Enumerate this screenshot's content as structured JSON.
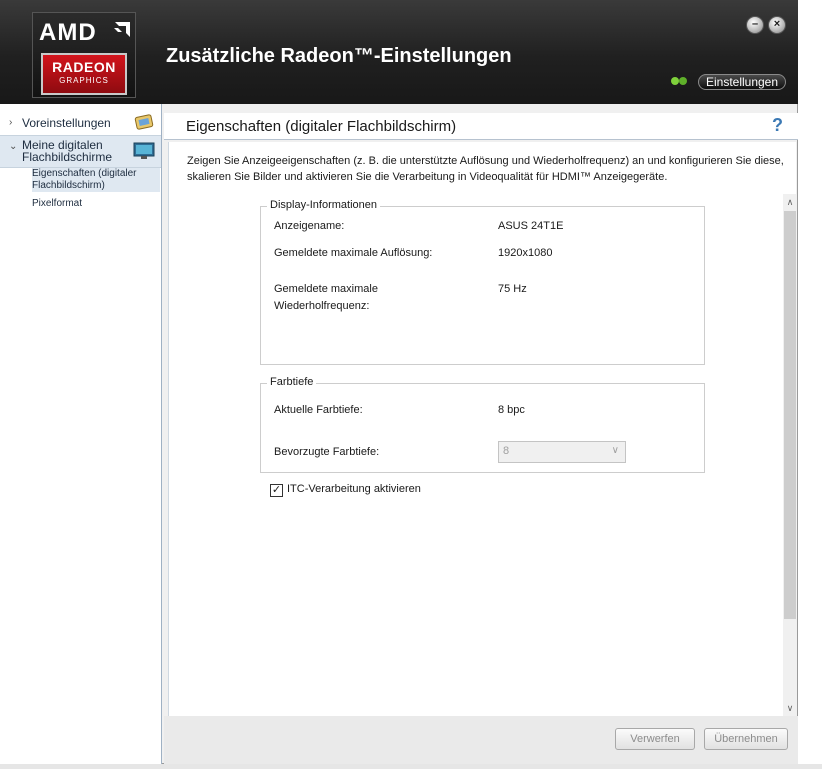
{
  "header": {
    "logo_text": "AMD",
    "logo_badge_line1": "RADEON",
    "logo_badge_line2": "GRAPHICS",
    "title": "Zusätzliche Radeon™-Einstellungen",
    "settings_button": "Einstellungen",
    "minimize_symbol": "–",
    "close_symbol": "×"
  },
  "sidebar": {
    "items": [
      {
        "label": "Voreinstellungen",
        "icon": "presets-icon"
      },
      {
        "label": "Meine digitalen Flachbildschirme",
        "icon": "monitor-icon"
      }
    ],
    "subitems": [
      "Eigenschaften (digitaler Flachbildschirm)",
      "Pixelformat"
    ]
  },
  "page": {
    "title": "Eigenschaften (digitaler Flachbildschirm)",
    "help": "?",
    "description": "Zeigen Sie Anzeigeeigenschaften (z. B. die unterstützte Auflösung und Wiederholfrequenz) an und konfigurieren Sie diese, skalieren Sie Bilder und aktivieren Sie die Verarbeitung in Videoqualität für HDMI™ Anzeigegeräte."
  },
  "display_info": {
    "title": "Display-Informationen",
    "rows": [
      {
        "label": "Anzeigename:",
        "value": "ASUS 24T1E"
      },
      {
        "label": "Gemeldete maximale Auflösung:",
        "value": "1920x1080"
      },
      {
        "label": "Gemeldete maximale Wiederholfrequenz:",
        "value": "75 Hz"
      }
    ]
  },
  "color_depth": {
    "title": "Farbtiefe",
    "current_label": "Aktuelle Farbtiefe:",
    "current_value": "8 bpc",
    "preferred_label": "Bevorzugte Farbtiefe:",
    "preferred_value": "8"
  },
  "itc": {
    "label": "ITC-Verarbeitung aktivieren",
    "checked": true
  },
  "footer": {
    "discard": "Verwerfen",
    "apply": "Übernehmen"
  },
  "colors": {
    "header_bg": "#202020",
    "amd_red": "#d3141c",
    "sidebar_selected": "#dfe8f1",
    "help_blue": "#3b79b4"
  }
}
